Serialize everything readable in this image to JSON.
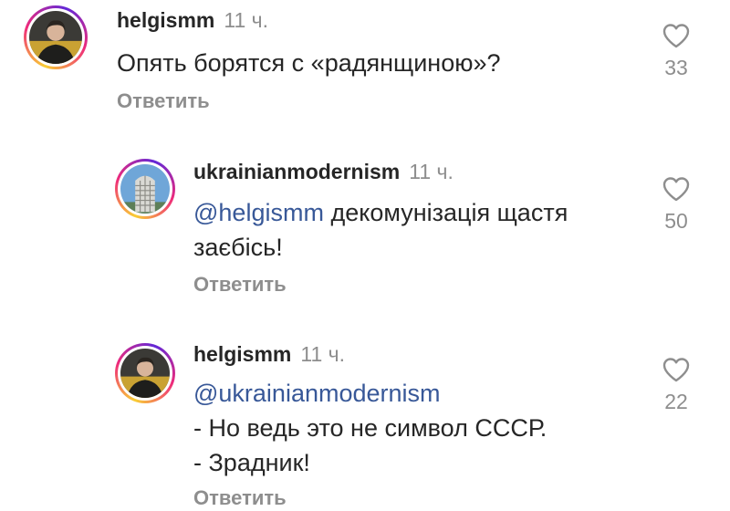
{
  "comments": [
    {
      "username": "helgismm",
      "time": "11 ч.",
      "text": "Опять борятся с «радянщиною»?",
      "reply_label": "Ответить",
      "likes": "33"
    },
    {
      "username": "ukrainianmodernism",
      "time": "11 ч.",
      "mention": "@helgismm",
      "text": " декомунізація щастя заєбісь!",
      "reply_label": "Ответить",
      "likes": "50"
    },
    {
      "username": "helgismm",
      "time": "11 ч.",
      "mention": "@ukrainianmodernism",
      "line1": "- Но ведь это не символ СССР.",
      "line2": "- Зрадник!",
      "reply_label": "Ответить",
      "likes": "22"
    }
  ],
  "icons": {
    "like": "heart-outline-icon"
  },
  "colors": {
    "text": "#262626",
    "secondary": "#8e8e8e",
    "mention": "#385898"
  }
}
